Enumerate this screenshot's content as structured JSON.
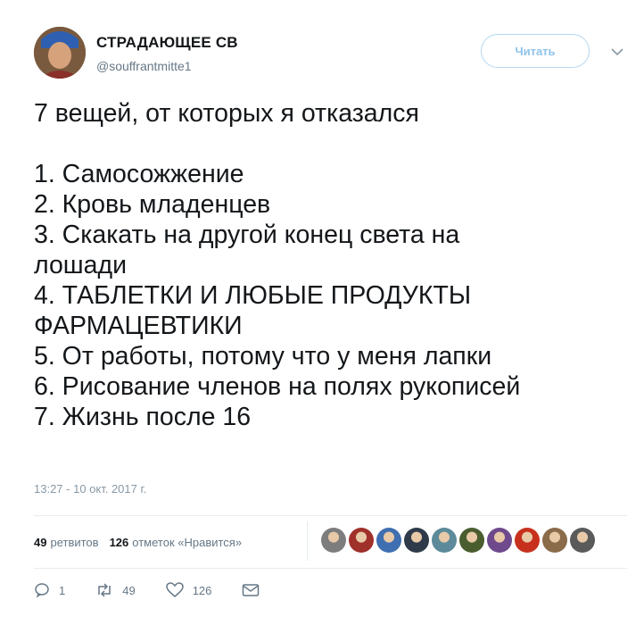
{
  "author": {
    "name": "СТРАДАЮЩЕЕ СВ",
    "handle": "@souffrantmitte1"
  },
  "follow_button_label": "Читать",
  "tweet": {
    "lines": [
      "7 вещей, от которых я отказался",
      "",
      "1. Самосожжение",
      "2. Кровь младенцев",
      "3. Скакать на другой конец света на",
      "лошади",
      "4. ТАБЛЕТКИ И ЛЮБЫЕ ПРОДУКТЫ",
      "ФАРМАЦЕВТИКИ",
      "5. От работы, потому что у меня лапки",
      "6. Рисование членов на полях рукописей",
      "7. Жизнь после 16"
    ],
    "timestamp": "13:27 - 10 окт. 2017 г."
  },
  "stats": {
    "retweets_count": "49",
    "retweets_label": "ретвитов",
    "likes_count": "126",
    "likes_label": "отметок «Нравится»"
  },
  "liker_avatar_colors": [
    "#7d7d7d",
    "#a0302a",
    "#3f6fb0",
    "#2f3b4a",
    "#5c8a9a",
    "#4a5d2f",
    "#6e4a8c",
    "#c8301e",
    "#8a6b4a",
    "#5a5a5a"
  ],
  "actions": {
    "reply_count": "1",
    "retweet_count": "49",
    "like_count": "126"
  },
  "colors": {
    "accent": "#1da1f2",
    "text": "#14171a",
    "muted": "#657786"
  }
}
